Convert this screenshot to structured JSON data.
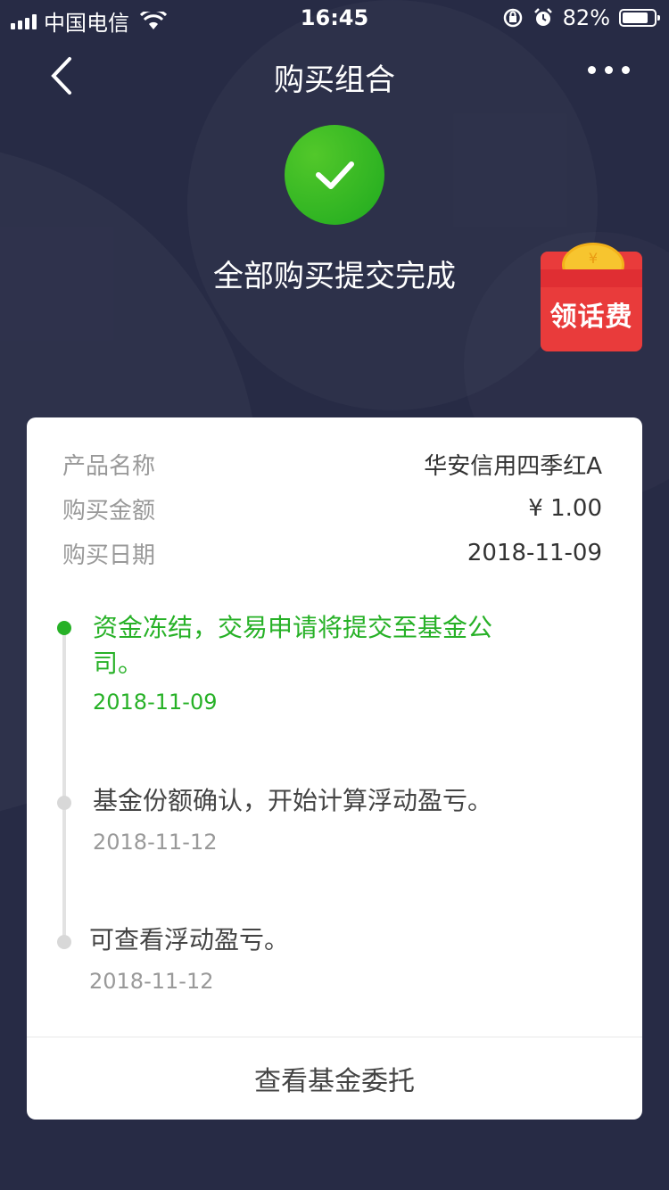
{
  "status_bar": {
    "carrier": "中国电信",
    "time": "16:45",
    "battery_pct": "82%",
    "battery_level": 0.82
  },
  "nav": {
    "title": "购买组合"
  },
  "success": {
    "message": "全部购买提交完成"
  },
  "promo": {
    "label": "领话费",
    "coin_symbol": "¥"
  },
  "details": [
    {
      "key": "产品名称",
      "value": "华安信用四季红A"
    },
    {
      "key": "购买金额",
      "value": "¥ 1.00"
    },
    {
      "key": "购买日期",
      "value": "2018-11-09"
    }
  ],
  "timeline": [
    {
      "text_line1": "资金冻结，交易申请将提交至基金公",
      "text_line2": "司。",
      "date": "2018-11-09",
      "status": "done"
    },
    {
      "text_line1": "基金份额确认，开始计算浮动盈亏。",
      "date": "2018-11-12",
      "status": "pending"
    },
    {
      "text_line1": "可查看浮动盈亏。",
      "date": "2018-11-12",
      "status": "pending"
    }
  ],
  "footer": {
    "button_label": "查看基金委托"
  },
  "colors": {
    "background": "#272b45",
    "accent_green": "#27b127",
    "promo_red": "#e93b3b"
  }
}
